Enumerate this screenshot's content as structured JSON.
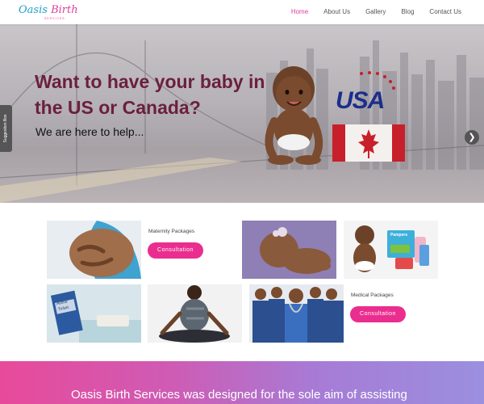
{
  "brand": {
    "logo_word1": "Oasis",
    "logo_word2": "Birth",
    "logo_tagline": "SERVICES"
  },
  "nav": {
    "items": [
      {
        "label": "Home",
        "active": true
      },
      {
        "label": "About Us",
        "active": false
      },
      {
        "label": "Gallery",
        "active": false
      },
      {
        "label": "Blog",
        "active": false
      },
      {
        "label": "Contact Us",
        "active": false
      }
    ]
  },
  "hero": {
    "headline": "Want to have your baby in the US or Canada?",
    "subheadline": "We are here to help...",
    "badge_text": "USA",
    "prev_icon": "chevron-left-icon",
    "next_icon": "chevron-right-icon",
    "slides": 2,
    "active_slide": 2
  },
  "suggestion_tab": {
    "label": "Suggestion Box"
  },
  "packages": {
    "maternity": {
      "title": "Maternity Packages",
      "button": "Consultation"
    },
    "medical": {
      "title": "Medical Packages",
      "button": "Consultation"
    },
    "ticket_text_1": "Airline",
    "ticket_text_2": "Ticket",
    "diaper_brand": "Pampers"
  },
  "band": {
    "text": "Oasis Birth Services was designed for the sole aim of assisting"
  },
  "colors": {
    "accent": "#e0409a",
    "button": "#ea2e8f",
    "headline": "#6b1f3f",
    "logo_blue": "#1f9fc9"
  }
}
